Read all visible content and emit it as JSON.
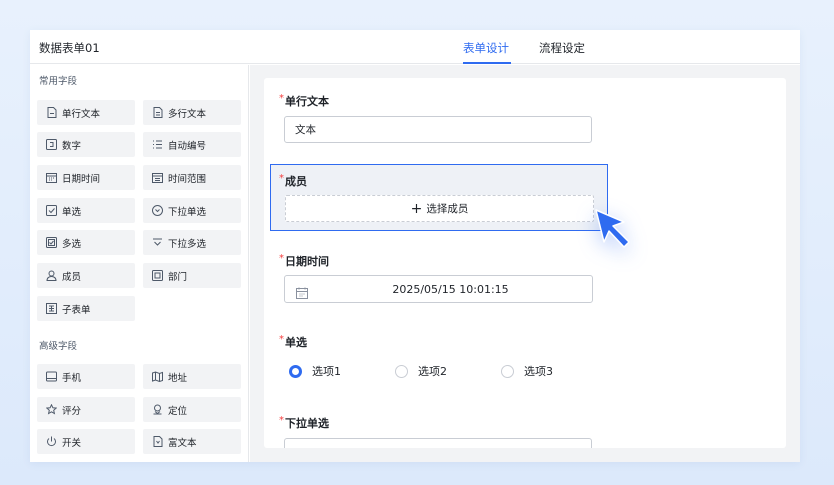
{
  "header": {
    "form_title": "数据表单01",
    "tabs": [
      {
        "label": "表单设计",
        "active": true
      },
      {
        "label": "流程设定",
        "active": false
      }
    ]
  },
  "sidebar": {
    "common_title": "常用字段",
    "common_fields": [
      {
        "label": "单行文本",
        "icon": "single-line-text-icon"
      },
      {
        "label": "多行文本",
        "icon": "multi-line-text-icon"
      },
      {
        "label": "数字",
        "icon": "number-icon"
      },
      {
        "label": "自动编号",
        "icon": "auto-number-icon"
      },
      {
        "label": "日期时间",
        "icon": "datetime-icon"
      },
      {
        "label": "时间范围",
        "icon": "time-range-icon"
      },
      {
        "label": "单选",
        "icon": "radio-icon"
      },
      {
        "label": "下拉单选",
        "icon": "dropdown-single-icon"
      },
      {
        "label": "多选",
        "icon": "checkbox-icon"
      },
      {
        "label": "下拉多选",
        "icon": "dropdown-multi-icon"
      },
      {
        "label": "成员",
        "icon": "member-icon"
      },
      {
        "label": "部门",
        "icon": "department-icon"
      },
      {
        "label": "子表单",
        "icon": "subform-icon"
      }
    ],
    "advanced_title": "高级字段",
    "advanced_fields": [
      {
        "label": "手机",
        "icon": "phone-icon"
      },
      {
        "label": "地址",
        "icon": "address-icon"
      },
      {
        "label": "评分",
        "icon": "star-icon"
      },
      {
        "label": "定位",
        "icon": "location-icon"
      },
      {
        "label": "开关",
        "icon": "power-icon"
      },
      {
        "label": "富文本",
        "icon": "rich-text-icon"
      }
    ]
  },
  "form": {
    "required_mark": "*",
    "single_text": {
      "label": "单行文本",
      "value": "文本"
    },
    "member": {
      "label": "成员",
      "plus": "+",
      "button_label": "选择成员"
    },
    "datetime": {
      "label": "日期时间",
      "value": "2025/05/15  10:01:15"
    },
    "radio": {
      "label": "单选",
      "options": [
        {
          "label": "选项1",
          "selected": true
        },
        {
          "label": "选项2",
          "selected": false
        },
        {
          "label": "选项3",
          "selected": false
        }
      ]
    },
    "dropdown_single": {
      "label": "下拉单选"
    }
  },
  "colors": {
    "accent": "#2f6bf0",
    "required": "#f53f3f",
    "field_bg": "#f2f3f5",
    "selected_bg": "#eef1f6"
  }
}
